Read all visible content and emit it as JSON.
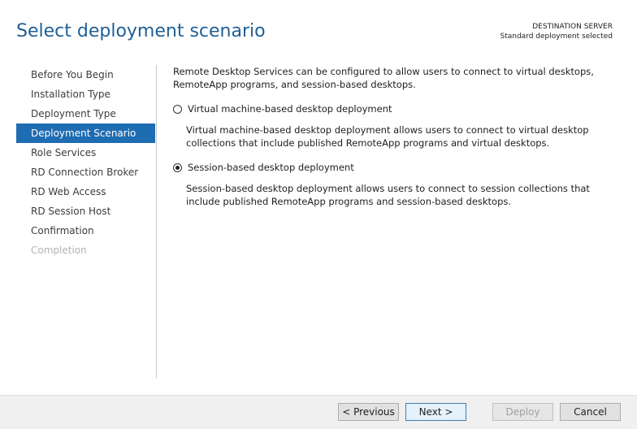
{
  "header": {
    "title": "Select deployment scenario",
    "destination_label": "DESTINATION SERVER",
    "destination_value": "Standard deployment selected"
  },
  "nav": {
    "items": [
      {
        "label": "Before You Begin",
        "state": "normal"
      },
      {
        "label": "Installation Type",
        "state": "normal"
      },
      {
        "label": "Deployment Type",
        "state": "normal"
      },
      {
        "label": "Deployment Scenario",
        "state": "active"
      },
      {
        "label": "Role Services",
        "state": "normal"
      },
      {
        "label": "RD Connection Broker",
        "state": "normal"
      },
      {
        "label": "RD Web Access",
        "state": "normal"
      },
      {
        "label": "RD Session Host",
        "state": "normal"
      },
      {
        "label": "Confirmation",
        "state": "normal"
      },
      {
        "label": "Completion",
        "state": "disabled"
      }
    ]
  },
  "content": {
    "intro": "Remote Desktop Services can be configured to allow users to connect to virtual desktops, RemoteApp programs, and session-based desktops.",
    "options": [
      {
        "label": "Virtual machine-based desktop deployment",
        "description": "Virtual machine-based desktop deployment allows users to connect to virtual desktop collections that include published RemoteApp programs and virtual desktops.",
        "selected": false
      },
      {
        "label": "Session-based desktop deployment",
        "description": "Session-based desktop deployment allows users to connect to session collections that include published RemoteApp programs and session-based desktops.",
        "selected": true
      }
    ]
  },
  "footer": {
    "previous_label": "< Previous",
    "next_label": "Next >",
    "deploy_label": "Deploy",
    "cancel_label": "Cancel"
  },
  "colors": {
    "title": "#1f5f96",
    "nav_active_bg": "#1e6cb2",
    "nav_disabled_text": "#b4b4b4",
    "footer_bg": "#f0f0f0"
  }
}
